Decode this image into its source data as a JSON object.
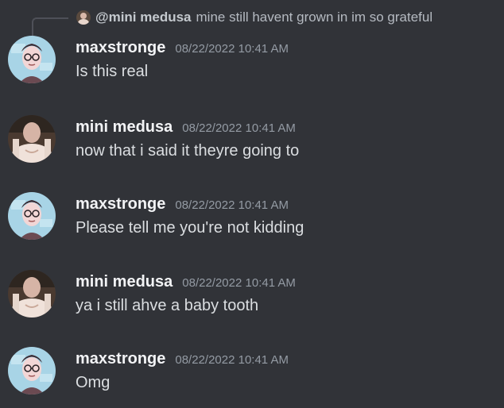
{
  "reply": {
    "mention": "@mini medusa",
    "text": "mine still havent grown in im so grateful"
  },
  "messages": [
    {
      "username": "maxstronge",
      "timestamp": "08/22/2022 10:41 AM",
      "text": "Is this real"
    },
    {
      "username": "mini medusa",
      "timestamp": "08/22/2022 10:41 AM",
      "text": "now that i said it theyre going to"
    },
    {
      "username": "maxstronge",
      "timestamp": "08/22/2022 10:41 AM",
      "text": "Please tell me you're not kidding"
    },
    {
      "username": "mini medusa",
      "timestamp": "08/22/2022 10:41 AM",
      "text": "ya i still ahve a baby tooth"
    },
    {
      "username": "maxstronge",
      "timestamp": "08/22/2022 10:41 AM",
      "text": "Omg"
    }
  ],
  "colors": {
    "background": "#313338",
    "username": "#f2f3f5",
    "timestamp": "#949ba4",
    "message_text": "#dbdee1",
    "reply_text": "#b5bac1"
  }
}
